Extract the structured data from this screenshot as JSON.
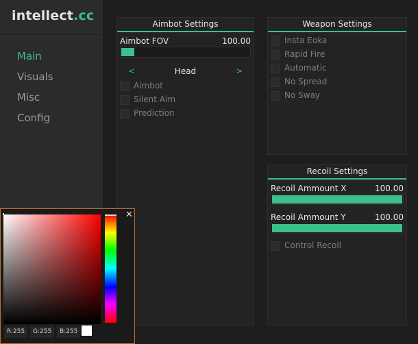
{
  "app": {
    "logo_main": "intellect",
    "logo_accent": ".cc",
    "accent_color": "#3cbf8c"
  },
  "nav": {
    "items": [
      {
        "label": "Main",
        "active": true
      },
      {
        "label": "Visuals",
        "active": false
      },
      {
        "label": "Misc",
        "active": false
      },
      {
        "label": "Config",
        "active": false
      }
    ]
  },
  "aimbot": {
    "title": "Aimbot Settings",
    "fov": {
      "label": "Aimbot FOV",
      "value_text": "100.00",
      "fill_fraction": 0.11
    },
    "target": {
      "prev": "<",
      "value": "Head",
      "next": ">"
    },
    "options": [
      "Aimbot",
      "Silent Aim",
      "Prediction"
    ]
  },
  "weapon": {
    "title": "Weapon Settings",
    "options": [
      "Insta Eoka",
      "Rapid Fire",
      "Automatic",
      "No Spread",
      "No Sway"
    ]
  },
  "recoil": {
    "title": "Recoil Settings",
    "x": {
      "label": "Recoil Ammount X",
      "value_text": "100.00",
      "fill_fraction": 1.0
    },
    "y": {
      "label": "Recoil Ammount Y",
      "value_text": "100.00",
      "fill_fraction": 1.0
    },
    "control_label": "Control Recoil"
  },
  "color_picker": {
    "close": "✕",
    "r": "R:255",
    "g": "G:255",
    "b": "B:255",
    "selected_color": "#ffffff"
  }
}
